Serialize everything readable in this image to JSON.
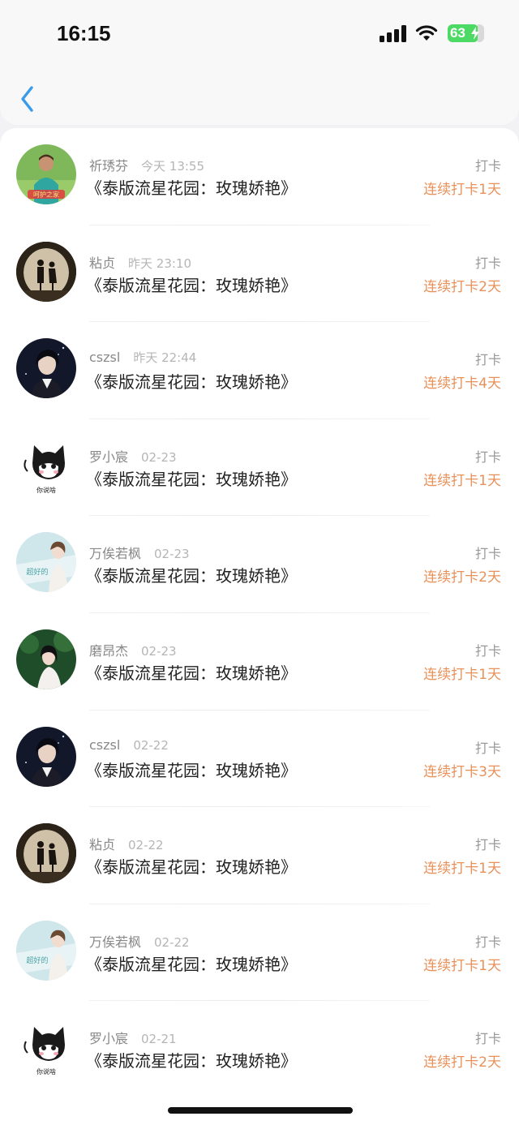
{
  "status_bar": {
    "time": "16:15",
    "battery": "63"
  },
  "list": {
    "items": [
      {
        "name": "祈琇芬",
        "time": "今天 13:55",
        "title": "《泰版流星花园：玫瑰娇艳》",
        "tag": "打卡",
        "streak": "连续打卡1天",
        "avatar": "green-portrait-avatar",
        "avatar_text": "呵护之家"
      },
      {
        "name": "粘贞",
        "time": "昨天 23:10",
        "title": "《泰版流星花园：玫瑰娇艳》",
        "tag": "打卡",
        "streak": "连续打卡2天",
        "avatar": "couple-silhouette-avatar"
      },
      {
        "name": "cszsl",
        "time": "昨天 22:44",
        "title": "《泰版流星花园：玫瑰娇艳》",
        "tag": "打卡",
        "streak": "连续打卡4天",
        "avatar": "dark-portrait-avatar"
      },
      {
        "name": "罗小宸",
        "time": "02-23",
        "title": "《泰版流星花园：玫瑰娇艳》",
        "tag": "打卡",
        "streak": "连续打卡1天",
        "avatar": "cartoon-cat-avatar",
        "avatar_text": "你说啥"
      },
      {
        "name": "万俟若枫",
        "time": "02-23",
        "title": "《泰版流星花园：玫瑰娇艳》",
        "tag": "打卡",
        "streak": "连续打卡2天",
        "avatar": "pastel-girl-avatar",
        "avatar_text": "超好的"
      },
      {
        "name": "磨昂杰",
        "time": "02-23",
        "title": "《泰版流星花园：玫瑰娇艳》",
        "tag": "打卡",
        "streak": "连续打卡1天",
        "avatar": "forest-girl-avatar"
      },
      {
        "name": "cszsl",
        "time": "02-22",
        "title": "《泰版流星花园：玫瑰娇艳》",
        "tag": "打卡",
        "streak": "连续打卡3天",
        "avatar": "dark-portrait-avatar"
      },
      {
        "name": "粘贞",
        "time": "02-22",
        "title": "《泰版流星花园：玫瑰娇艳》",
        "tag": "打卡",
        "streak": "连续打卡1天",
        "avatar": "couple-silhouette-avatar"
      },
      {
        "name": "万俟若枫",
        "time": "02-22",
        "title": "《泰版流星花园：玫瑰娇艳》",
        "tag": "打卡",
        "streak": "连续打卡1天",
        "avatar": "pastel-girl-avatar",
        "avatar_text": "超好的"
      },
      {
        "name": "罗小宸",
        "time": "02-21",
        "title": "《泰版流星花园：玫瑰娇艳》",
        "tag": "打卡",
        "streak": "连续打卡2天",
        "avatar": "cartoon-cat-avatar",
        "avatar_text": "你说啥"
      }
    ]
  },
  "colors": {
    "accent_back": "#3a9be8",
    "streak": "#e8915a",
    "battery": "#4cd964"
  }
}
